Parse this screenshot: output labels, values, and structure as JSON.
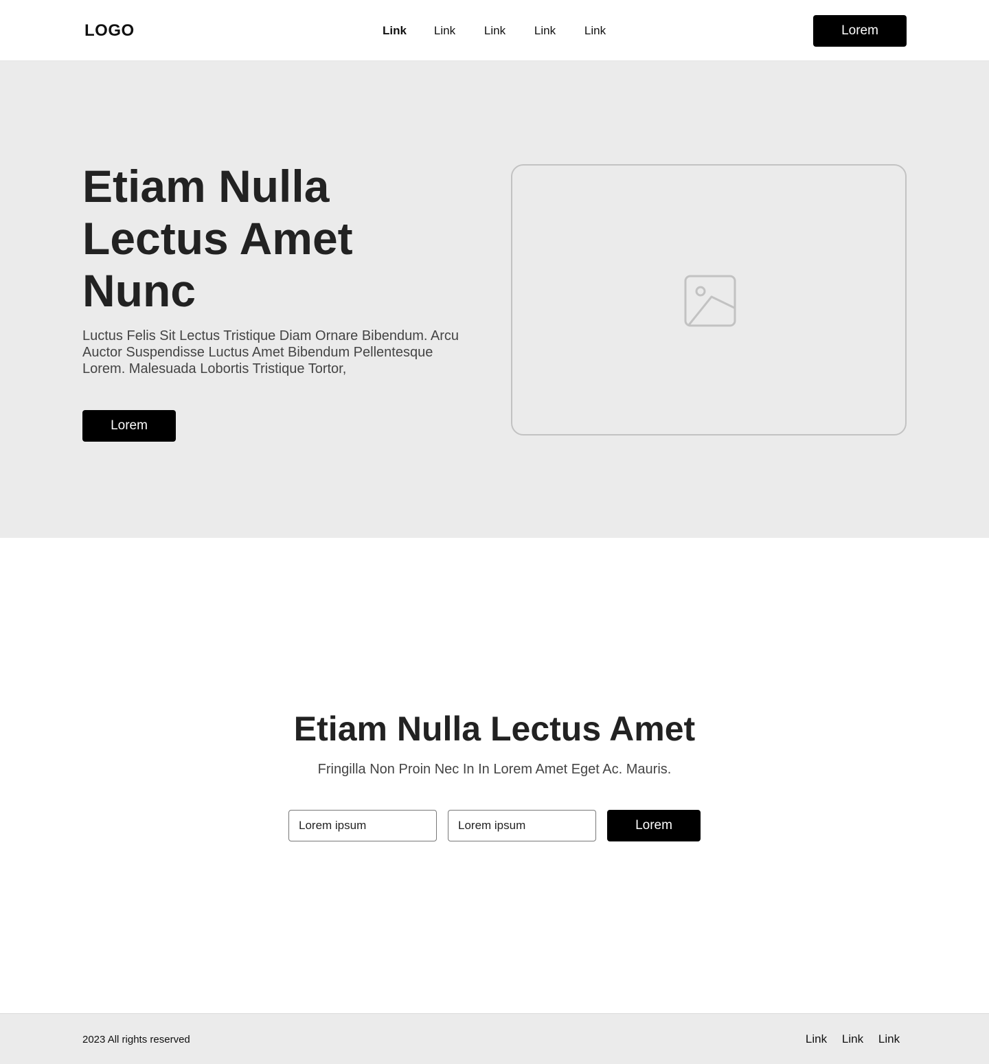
{
  "header": {
    "logo": "LOGO",
    "nav": [
      {
        "label": "Link",
        "active": true
      },
      {
        "label": "Link",
        "active": false
      },
      {
        "label": "Link",
        "active": false
      },
      {
        "label": "Link",
        "active": false
      },
      {
        "label": "Link",
        "active": false
      }
    ],
    "button_label": "Lorem"
  },
  "hero": {
    "title": "Etiam Nulla Lectus Amet Nunc",
    "description": "Luctus Felis Sit Lectus Tristique Diam Ornare Bibendum. Arcu Auctor Suspendisse Luctus Amet Bibendum Pellentesque Lorem. Malesuada Lobortis Tristique Tortor,",
    "button_label": "Lorem",
    "image_icon": "image-placeholder-icon"
  },
  "cta": {
    "title": "Etiam Nulla Lectus Amet",
    "subtitle": "Fringilla Non Proin Nec In In Lorem Amet Eget Ac. Mauris.",
    "inputs": [
      {
        "placeholder": "Lorem ipsum"
      },
      {
        "placeholder": "Lorem ipsum"
      }
    ],
    "button_label": "Lorem"
  },
  "footer": {
    "copyright": "2023 All rights reserved",
    "links": [
      "Link",
      "Link",
      "Link"
    ]
  },
  "colors": {
    "section_background": "#ebebeb",
    "button_background": "#000000",
    "button_text": "#ffffff",
    "heading_text": "#222222",
    "body_text": "#444444"
  }
}
